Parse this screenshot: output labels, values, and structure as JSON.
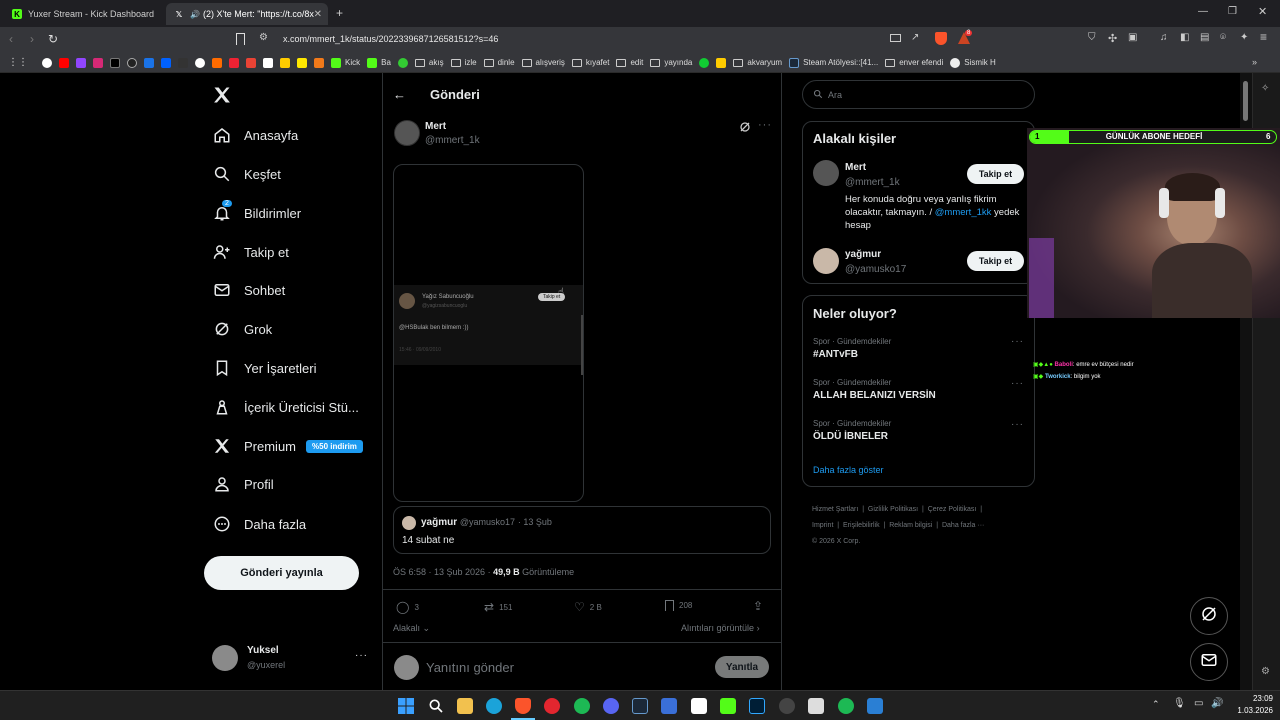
{
  "browser": {
    "tabs": [
      {
        "title": "Yuxer Stream - Kick Dashboard"
      },
      {
        "title": "(2) X'te Mert: \"https://t.co/8x"
      }
    ],
    "url": "x.com/mmert_1k/status/2022339687126581512?s=46",
    "ext_badge": "8",
    "bookmarks": [
      "",
      "",
      "",
      "",
      "",
      "",
      "",
      "",
      "",
      "",
      "",
      "",
      "",
      "",
      "",
      "",
      "",
      "",
      "Kick",
      "Ba",
      "",
      "akış",
      "izle",
      "dinle",
      "alışveriş",
      "kıyafet",
      "edit",
      "yayında",
      "",
      "",
      "akvaryum",
      "Steam Atölyesi::[41...",
      "enver efendi",
      "Sismik H"
    ]
  },
  "sidebar": {
    "items": [
      {
        "label": "Anasayfa",
        "icon": "home-icon"
      },
      {
        "label": "Keşfet",
        "icon": "search-icon"
      },
      {
        "label": "Bildirimler",
        "icon": "bell-icon",
        "badge": "2"
      },
      {
        "label": "Takip et",
        "icon": "follow-icon"
      },
      {
        "label": "Sohbet",
        "icon": "mail-icon"
      },
      {
        "label": "Grok",
        "icon": "grok-icon"
      },
      {
        "label": "Yer İşaretleri",
        "icon": "bookmark-icon"
      },
      {
        "label": "İçerik Üreticisi Stü...",
        "icon": "creator-icon"
      },
      {
        "label": "Premium",
        "icon": "x-icon",
        "badge": "%50 indirim"
      },
      {
        "label": "Profil",
        "icon": "person-icon"
      },
      {
        "label": "Daha fazla",
        "icon": "more-icon"
      }
    ],
    "post_button": "Gönderi yayınla",
    "account": {
      "name": "Yuksel",
      "handle": "@yuxerel"
    }
  },
  "main": {
    "header_title": "Gönderi",
    "author": {
      "name": "Mert",
      "handle": "@mmert_1k"
    },
    "embedded": {
      "name": "Yağız Sabuncuoğlu",
      "handle": "@yagizsabuncuoglu",
      "text": "@HSBulak ben bilmem :))",
      "meta": "15:46 · 09/09/2010",
      "button": "Takip et"
    },
    "quoted": {
      "name": "yağmur",
      "handle": "@yamusko17",
      "date": "· 13 Şub",
      "text": "14 subat ne"
    },
    "timestamp": "ÖS 6:58 · 13 Şub 2026 ·",
    "views_count": "49,9 B",
    "views_label": "Görüntüleme",
    "actions": {
      "replies": "3",
      "reposts": "151",
      "likes": "2 B",
      "bookmarks": "208"
    },
    "relevance": "Alakalı",
    "quotes_link": "Alıntıları görüntüle",
    "reply_placeholder": "Yanıtını gönder",
    "reply_button": "Yanıtla"
  },
  "right": {
    "search_placeholder": "Ara",
    "relevant_title": "Alakalı kişiler",
    "people": [
      {
        "name": "Mert",
        "handle": "@mmert_1k",
        "bio": "Her konuda doğru veya yanlış fikrim olacaktır, takmayın. /",
        "bio_link": "@mmert_1kk",
        "bio_tail": "yedek hesap",
        "button": "Takip et"
      },
      {
        "name": "yağmur",
        "handle": "@yamusko17",
        "button": "Takip et"
      }
    ],
    "trends_title": "Neler oluyor?",
    "trends": [
      {
        "category": "Spor · Gündemdekiler",
        "name": "#ANTvFB"
      },
      {
        "category": "Spor · Gündemdekiler",
        "name": "ALLAH BELANIZI VERSİN"
      },
      {
        "category": "Spor · Gündemdekiler",
        "name": "ÖLDÜ İBNELER"
      }
    ],
    "show_more": "Daha fazla göster",
    "footer": [
      "Hizmet Şartları",
      "|",
      "Gizlilik Politikası",
      "|",
      "Çerez Politikası",
      "|",
      "Imprint",
      "|",
      "Erişilebilirlik",
      "|",
      "Reklam bilgisi",
      "|",
      "Daha fazla ···"
    ],
    "copyright": "© 2026 X Corp."
  },
  "overlay": {
    "goal_left": "1",
    "goal_title": "GÜNLÜK ABONE HEDEFİ",
    "goal_right": "6",
    "goal_progress": 0.16,
    "chat": [
      {
        "user": "Baboli",
        "text": ": emre ev bütçesi nedir"
      },
      {
        "user": "Tworkick",
        "text": ": bilgim yok"
      }
    ]
  },
  "taskbar": {
    "time": "23:09",
    "date": "1.03.2026"
  },
  "colors": {
    "accent": "#1d9bf0",
    "bg": "#000000",
    "border": "#2f3336",
    "muted": "#71767b",
    "goal": "#53fc18"
  }
}
